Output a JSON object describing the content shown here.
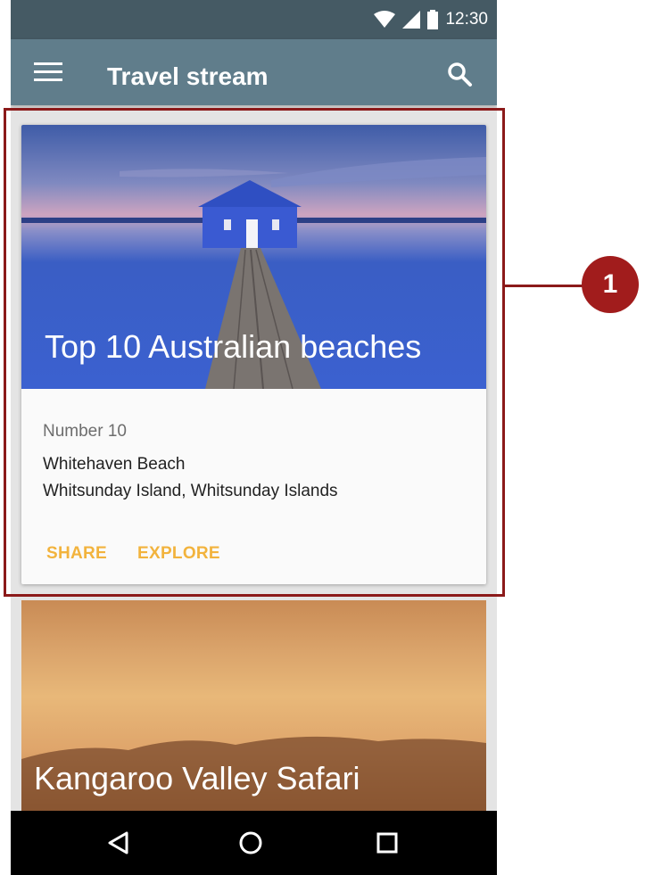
{
  "status_bar": {
    "time": "12:30",
    "icons": [
      "wifi-icon",
      "cell-signal-icon",
      "battery-icon"
    ]
  },
  "app_bar": {
    "title": "Travel stream",
    "menu_icon": "menu-icon",
    "search_icon": "search-icon"
  },
  "card": {
    "title": "Top 10 Australian beaches",
    "subtitle": "Number 10",
    "line1": "Whitehaven Beach",
    "line2": "Whitsunday Island, Whitsunday Islands",
    "actions": [
      "SHARE",
      "EXPLORE"
    ]
  },
  "card2": {
    "title": "Kangaroo Valley Safari"
  },
  "nav_bar": {
    "icons": [
      "back-icon",
      "home-icon",
      "recents-icon"
    ]
  },
  "callout": {
    "label": "1"
  },
  "colors": {
    "status_bar": "#455a64",
    "app_bar": "#607d8b",
    "action_text": "#f2b33d",
    "callout": "#8b1a1a"
  }
}
